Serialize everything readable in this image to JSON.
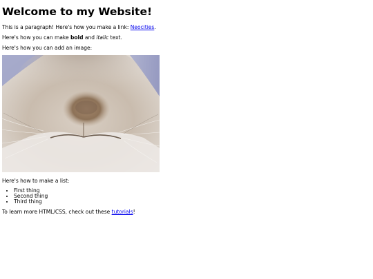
{
  "heading": "Welcome to my Website!",
  "paragraph1": {
    "text": "This is a paragraph! Here's how you make a link: ",
    "link_label": "Neocities",
    "suffix": "."
  },
  "paragraph2": {
    "prefix": "Here's how you can make ",
    "bold": "bold",
    "middle": " and ",
    "italic": "italic",
    "suffix": " text."
  },
  "paragraph3": "Here's how you can add an image:",
  "image": {
    "subject": "rabbit-nose-closeup",
    "colors": {
      "fur_light": "#e6e2de",
      "fur_mid": "#b9aa9c",
      "fur_brown": "#a38a6f",
      "nose_dark": "#6f5643",
      "background_blue": "#9aa0c8"
    }
  },
  "paragraph4": "Here's how to make a list:",
  "list_items": [
    "First thing",
    "Second thing",
    "Third thing"
  ],
  "paragraph5": {
    "prefix": "To learn more HTML/CSS, check out these ",
    "link_label": "tutorials",
    "suffix": "!"
  },
  "colors": {
    "link": "#0000ee",
    "text": "#000000",
    "background": "#ffffff"
  }
}
